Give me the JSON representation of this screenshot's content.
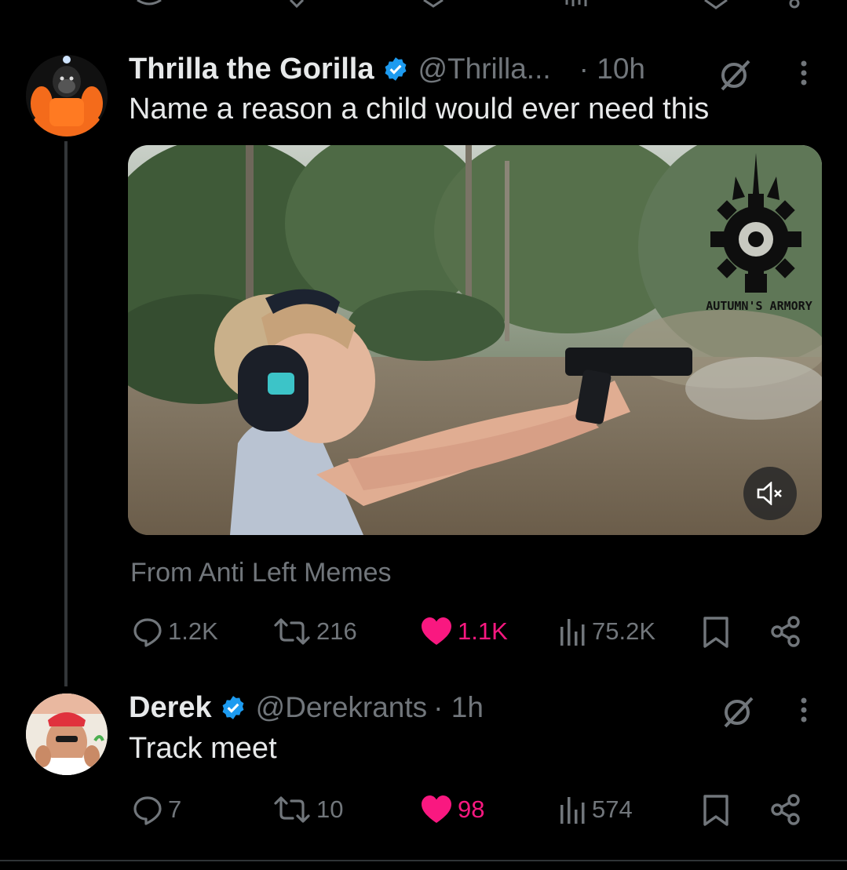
{
  "tweet": {
    "author_name": "Thrilla the Gorilla",
    "handle": "@Thrilla...",
    "time": "· 10h",
    "text": "Name a reason a child would ever need this",
    "source": "From Anti Left Memes",
    "video_watermark": "AUTUMN'S ARMORY",
    "stats": {
      "replies": "1.2K",
      "reposts": "216",
      "likes": "1.1K",
      "views": "75.2K"
    }
  },
  "reply": {
    "author_name": "Derek",
    "handle": "@Derekrants",
    "time": "· 1h",
    "text": "Track meet",
    "stats": {
      "replies": "7",
      "reposts": "10",
      "likes": "98",
      "views": "574"
    }
  },
  "colors": {
    "verified": "#1d9bf0",
    "like": "#f91880",
    "muted": "#71767b",
    "text": "#e7e9ea",
    "background": "#000000"
  }
}
